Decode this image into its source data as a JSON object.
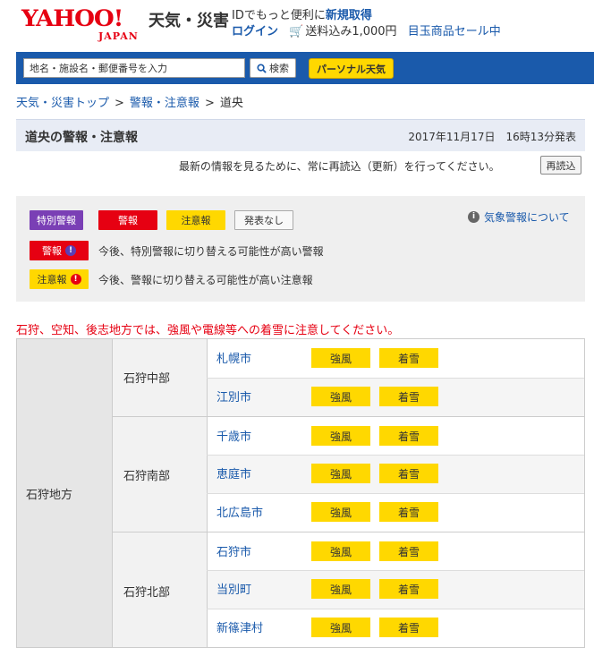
{
  "header": {
    "logo_main": "YAHOO!",
    "logo_sub": "JAPAN",
    "service_name": "天気・災害",
    "promo_line1_prefix": "IDでもっと便利に",
    "promo_line1_link": "新規取得",
    "login": "ログイン",
    "cart_promo": "送料込み1,000円",
    "sale_link": "目玉商品セール中"
  },
  "search": {
    "placeholder": "地名・施設名・郵便番号を入力",
    "value": "地名・施設名・郵便番号を入力",
    "button": "検索",
    "personal_button": "パーソナル天気"
  },
  "breadcrumb": {
    "items": [
      "天気・災害トップ",
      "警報・注意報",
      "道央"
    ],
    "separator": ">"
  },
  "page": {
    "title": "道央の警報・注意報",
    "issued": "2017年11月17日　16時13分発表",
    "notice": "最新の情報を見るために、常に再読込（更新）を行ってください。",
    "reload_button": "再読込"
  },
  "legend": {
    "special_warning": "特別警報",
    "warning": "警報",
    "advisory": "注意報",
    "none": "発表なし",
    "about_link": "気象警報について",
    "warning_possible_label": "警報",
    "warning_possible_desc": "今後、特別警報に切り替える可能性が高い警報",
    "advisory_possible_label": "注意報",
    "advisory_possible_desc": "今後、警報に切り替える可能性が高い注意報",
    "excl": "!"
  },
  "alert_message": "石狩、空知、後志地方では、強風や電線等への着雪に注意してください。",
  "table": {
    "region": "石狩地方",
    "subregions": [
      {
        "name": "石狩中部",
        "cities": [
          {
            "name": "札幌市",
            "tags": [
              "強風",
              "着雪"
            ]
          },
          {
            "name": "江別市",
            "tags": [
              "強風",
              "着雪"
            ]
          }
        ]
      },
      {
        "name": "石狩南部",
        "cities": [
          {
            "name": "千歳市",
            "tags": [
              "強風",
              "着雪"
            ]
          },
          {
            "name": "恵庭市",
            "tags": [
              "強風",
              "着雪"
            ]
          },
          {
            "name": "北広島市",
            "tags": [
              "強風",
              "着雪"
            ]
          }
        ]
      },
      {
        "name": "石狩北部",
        "cities": [
          {
            "name": "石狩市",
            "tags": [
              "強風",
              "着雪"
            ]
          },
          {
            "name": "当別町",
            "tags": [
              "強風",
              "着雪"
            ]
          },
          {
            "name": "新篠津村",
            "tags": [
              "強風",
              "着雪"
            ]
          }
        ]
      }
    ]
  },
  "colors": {
    "brand_red": "#e60012",
    "link_blue": "#1a5aab",
    "advisory_yellow": "#ffd800",
    "special_purple": "#7a3fb5"
  }
}
